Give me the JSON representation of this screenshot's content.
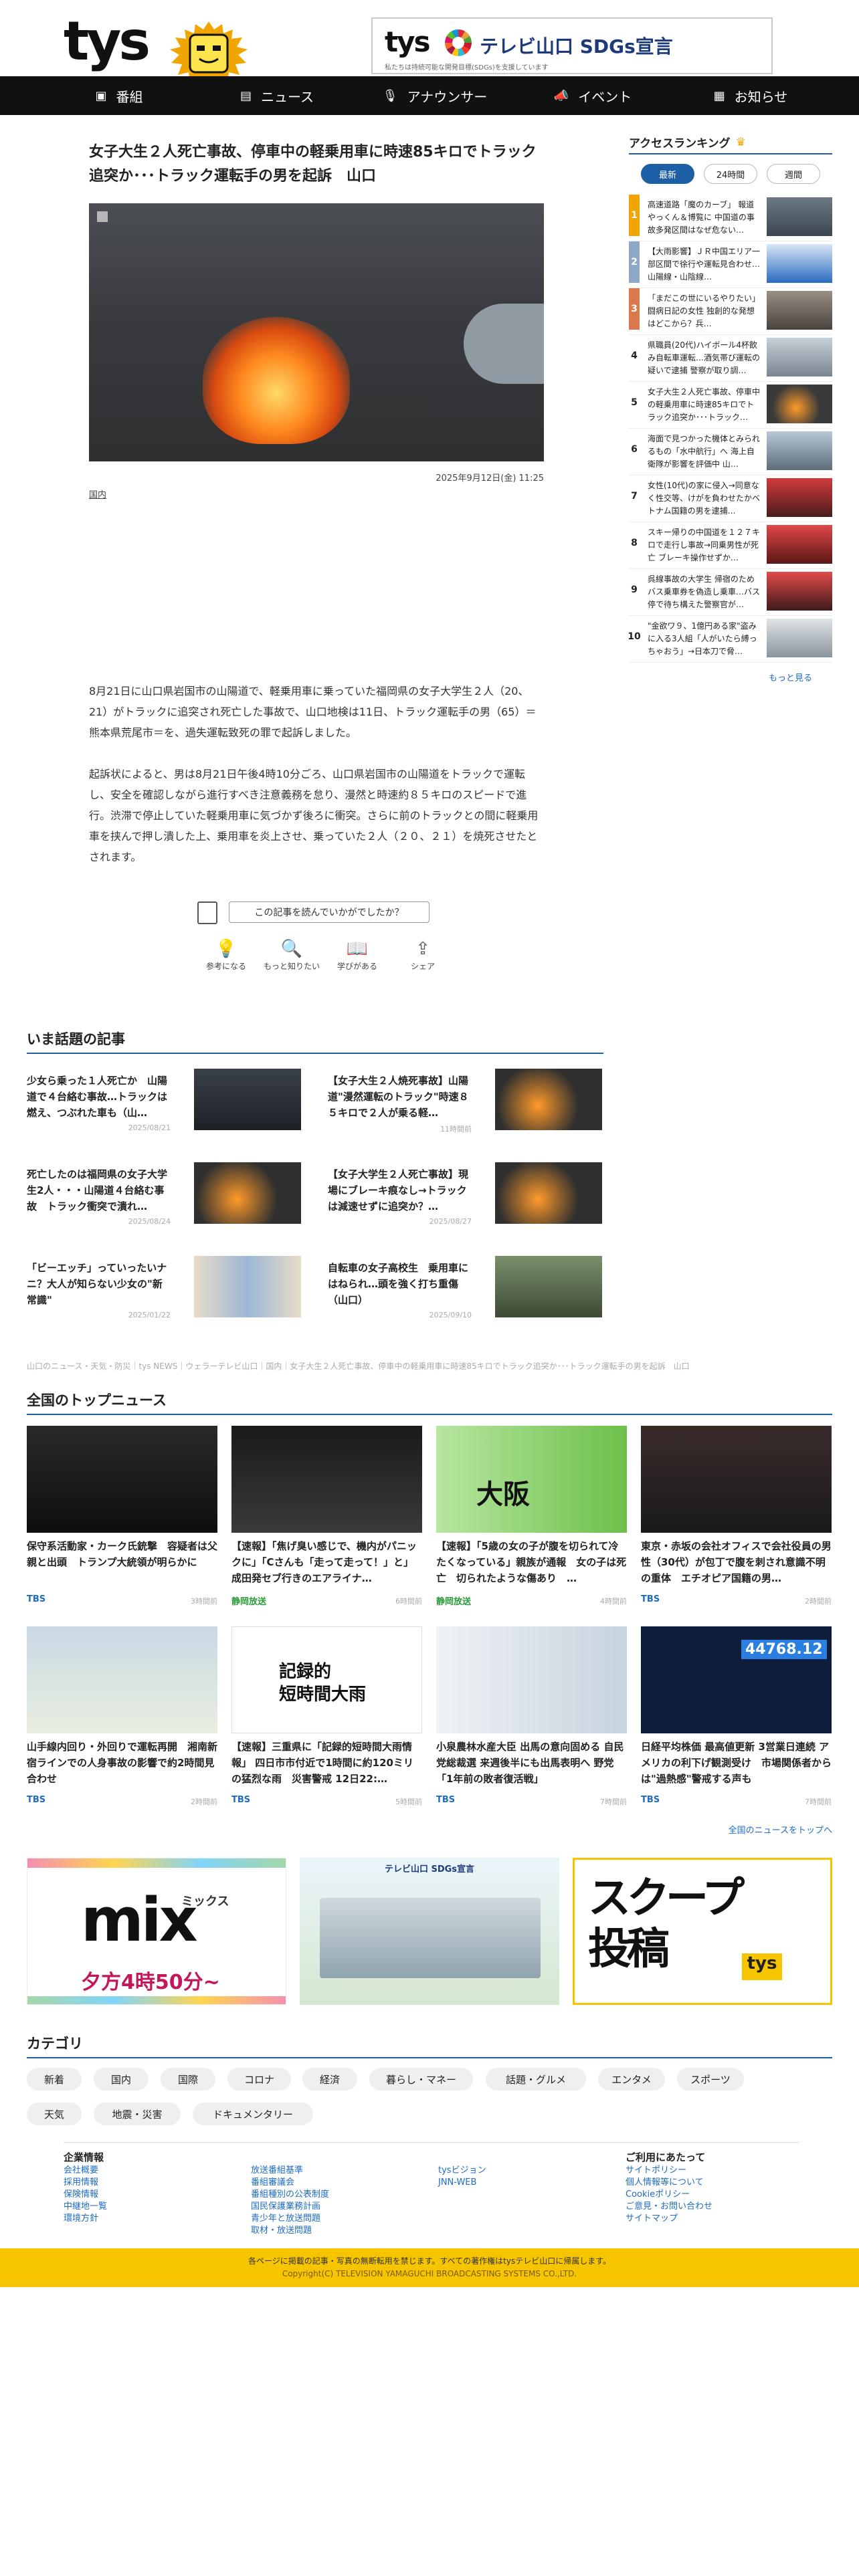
{
  "header": {
    "logo": "tys",
    "sdgs_logo": "tys",
    "sdgs_title": "テレビ山口 SDGs宣言",
    "sdgs_sub": "私たちは持続可能な開発目標(SDGs)を支援しています"
  },
  "nav": [
    {
      "label": "番組",
      "icon": "tv-icon"
    },
    {
      "label": "ニュース",
      "icon": "news-icon"
    },
    {
      "label": "アナウンサー",
      "icon": "microphone-icon"
    },
    {
      "label": "イベント",
      "icon": "megaphone-icon"
    },
    {
      "label": "お知らせ",
      "icon": "notice-icon"
    }
  ],
  "article": {
    "title": "女子大生２人死亡事故、停車中の軽乗用車に時速85キロでトラック追突か･･･トラック運転手の男を起訴　山口",
    "date": "2025年9月12日(金) 11:25",
    "category": "国内",
    "paragraph1": "8月21日に山口県岩国市の山陽道で、軽乗用車に乗っていた福岡県の女子大学生２人（20、21）がトラックに追突され死亡した事故で、山口地検は11日、トラック運転手の男（65）＝熊本県荒尾市＝を、過失運転致死の罪で起訴しました。",
    "paragraph2": "起訴状によると、男は8月21日午後4時10分ごろ、山口県岩国市の山陽道をトラックで運転し、安全を確認しながら進行すべき注意義務を怠り、漫然と時速約８５キロのスピードで進行。渋滞で停止していた軽乗用車に気づかず後ろに衝突。さらに前のトラックとの間に軽乗用車を挟んで押し潰した上、乗用車を炎上させ、乗っていた２人（２０、２１）を焼死させたとされます。",
    "rating_question": "この記事を読んでいかがでしたか？",
    "reactions": [
      {
        "label": "参考になる",
        "icon": "lightbulb-icon"
      },
      {
        "label": "もっと知りたい",
        "icon": "magnifier-icon"
      },
      {
        "label": "学びがある",
        "icon": "book-icon"
      },
      {
        "label": "シェア",
        "icon": "share-icon"
      }
    ]
  },
  "ranking": {
    "title": "アクセスランキング",
    "tabs": [
      "最新",
      "24時間",
      "週間"
    ],
    "items": [
      {
        "num": "1",
        "text": "高速道路「魔のカーブ」 報道やっくん＆博覧に 中国道の事故多発区間はなぜ危ない…"
      },
      {
        "num": "2",
        "text": "【大雨影響】ＪＲ中国エリア一部区間で徐行や運転見合わせ…山陽線・山陰線…"
      },
      {
        "num": "3",
        "text": "「まだこの世にいるやりたい」闘病日記の女性 独創的な発想はどこから？兵…"
      },
      {
        "num": "4",
        "text": "県職員(20代)ハイボール4杯飲み自転車運転…酒気帯び運転の疑いで逮捕 警察が取り調…"
      },
      {
        "num": "5",
        "text": "女子大生２人死亡事故、停車中の軽乗用車に時速85キロでトラック追突か･･･トラック…"
      },
      {
        "num": "6",
        "text": "海面で見つかった機体とみられるもの「水中航行」へ 海上自衛隊が影響を評価中 山…"
      },
      {
        "num": "7",
        "text": "女性(10代)の家に侵入→同意なく性交等、けがを負わせたかベトナム国籍の男を逮捕…"
      },
      {
        "num": "8",
        "text": "スキー帰りの中国道を１２７キロで走行し事故→同乗男性が死亡 ブレーキ操作せずか…"
      },
      {
        "num": "9",
        "text": "呉線事故の大学生 帰宿のためバス乗車券を偽造し乗車…バス停で待ち構えた警察官が…"
      },
      {
        "num": "10",
        "text": "\"金欲ワ９、1億円ある家\"盗みに入る3人組「人がいたら縛っちゃおう」→日本刀で脅…"
      }
    ],
    "more": "もっと見る"
  },
  "popular": {
    "title": "いま話題の記事",
    "items": [
      {
        "title": "少女ら乗った１人死亡か　山陽道で４台絡む事故…トラックは燃え、つぶれた車も（山…",
        "date": "2025/08/21"
      },
      {
        "title": "【女子大生２人焼死事故】山陽道\"漫然運転のトラック\"時速８５キロで２人が乗る軽…",
        "date": "11時間前"
      },
      {
        "title": "死亡したのは福岡県の女子大学生2人・・・山陽道４台絡む事故　トラック衝突で潰れ…",
        "date": "2025/08/24"
      },
      {
        "title": "【女子大学生２人死亡事故】現場にブレーキ痕なし→トラックは減速せずに追突か？…",
        "date": "2025/08/27"
      },
      {
        "title": "「ビーエッチ」っていったいナニ？大人が知らない少女の\"新常識\"",
        "date": "2025/01/22"
      },
      {
        "title": "自転車の女子高校生　乗用車にはねられ…頭を強く打ち重傷（山口）",
        "date": "2025/09/10"
      }
    ]
  },
  "breadcrumb": "山口のニュース・天気・防災｜tys NEWS｜ウェラーテレビ山口｜国内｜女子大生２人死亡事故、停車中の軽乗用車に時速85キロでトラック追突か･･･トラック運転手の男を起訴　山口",
  "top_news": {
    "title": "全国のトップニュース",
    "items": [
      {
        "title": "保守系活動家・カーク氏銃撃　容疑者は父親と出頭　トランプ大統領が明らかに",
        "source": "TBS",
        "time": "3時間前",
        "color": "#1d6bc4"
      },
      {
        "title": "【速報】「焦げ臭い感じで、機内がパニックに」「Cさんも「走って走って！」と」 成田発セブ行きのエアライナ…",
        "source": "静岡放送",
        "time": "6時間前",
        "color": "#2a9c3a"
      },
      {
        "title": "【速報】「5歳の女の子が腹を切られて冷たくなっている」親族が通報　女の子は死亡　切られたような傷あり　…",
        "source": "静岡放送",
        "time": "4時間前",
        "color": "#2a9c3a"
      },
      {
        "title": "東京・赤坂の会社オフィスで会社役員の男性（30代）が包丁で腹を刺され意識不明の重体　エチオピア国籍の男…",
        "source": "TBS",
        "time": "2時間前",
        "color": "#1d6bc4"
      },
      {
        "title": "山手線内回り・外回りで運転再開　湘南新宿ラインでの人身事故の影響で約2時間見合わせ",
        "source": "TBS",
        "time": "2時間前",
        "color": "#1d6bc4"
      },
      {
        "title": "【速報】三重県に「記録的短時間大雨情報」 四日市市付近で1時間に約120ミリの猛烈な雨　災害警戒 12日22:…",
        "source": "TBS",
        "time": "5時間前",
        "color": "#1d6bc4"
      },
      {
        "title": "小泉農林水産大臣 出馬の意向固める 自民党総裁選 来週後半にも出馬表明へ 野党「1年前の敗者復活戦」",
        "source": "TBS",
        "time": "7時間前",
        "color": "#1d6bc4"
      },
      {
        "title": "日経平均株価 最高値更新 3営業日連続 アメリカの利下げ観測受け　市場関係者からは\"過熱感\"警戒する声も",
        "source": "TBS",
        "time": "7時間前",
        "color": "#1d6bc4"
      }
    ],
    "more": "全国のニュースをトップへ"
  },
  "promos": {
    "mix_title": "mix",
    "mix_kana": "ミックス",
    "mix_time": "夕方4時50分~",
    "sdgs_caption": "テレビ山口 SDGs宣言",
    "scoop_title": "スクープ投稿",
    "scoop_logo": "tys"
  },
  "categories": {
    "title": "カテゴリ",
    "items": [
      "新着",
      "国内",
      "国際",
      "コロナ",
      "経済",
      "暮らし・マネー",
      "話題・グルメ",
      "エンタメ",
      "スポーツ",
      "天気",
      "地震・災害",
      "ドキュメンタリー"
    ]
  },
  "footer": {
    "col1_title": "企業情報",
    "col1": [
      "会社概要",
      "採用情報",
      "保険情報",
      "中継地一覧",
      "環境方針"
    ],
    "col2": [
      "放送番組基準",
      "番組審議会",
      "番組種別の公表制度",
      "国民保護業務計画",
      "青少年と放送問題",
      "取材・放送問題"
    ],
    "col3": [
      "tysビジョン",
      "JNN-WEB"
    ],
    "col4_title": "ご利用にあたって",
    "col4": [
      "サイトポリシー",
      "個人情報等について",
      "Cookieポリシー",
      "ご意見・お問い合わせ",
      "サイトマップ"
    ],
    "notice": "各ページに掲載の記事・写真の無断転用を禁じます。すべての著作権はtysテレビ山口に帰属します。",
    "copyright": "Copyright(C) TELEVISION YAMAGUCHI BROADCASTING SYSTEMS CO.,LTD."
  },
  "colors": {
    "accent": "#1d5fa5",
    "nav_bg": "#111111",
    "brand_yellow": "#f7c400",
    "link": "#1d6bc4"
  }
}
